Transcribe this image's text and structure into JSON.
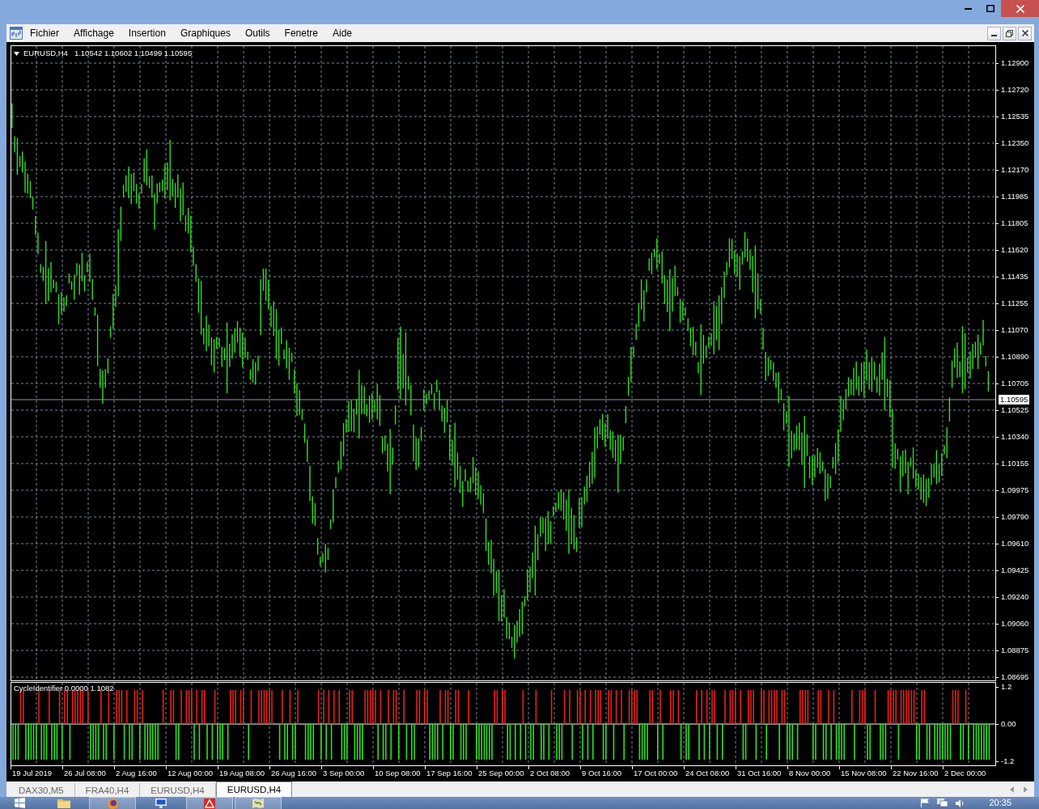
{
  "menu": [
    "Fichier",
    "Affichage",
    "Insertion",
    "Graphiques",
    "Outils",
    "Fenetre",
    "Aide"
  ],
  "chart": {
    "symbol": "EURUSD,H4",
    "ohlc": "1.10542 1.10602 1.10499 1.10595",
    "price_axis": [
      "1.12900",
      "1.12720",
      "1.12535",
      "1.12350",
      "1.12170",
      "1.11985",
      "1.11805",
      "1.11620",
      "1.11435",
      "1.11255",
      "1.11070",
      "1.10890",
      "1.10705",
      "1.10525",
      "1.10340",
      "1.10155",
      "1.09975",
      "1.09790",
      "1.09610",
      "1.09425",
      "1.09240",
      "1.09060",
      "1.08875",
      "1.08695"
    ],
    "current_price": "1.10595"
  },
  "indicator": {
    "label": "CycleIdentifier 0.0000 1.1082",
    "axis": [
      "1.2",
      "0.00",
      "-1.2"
    ]
  },
  "time_axis": [
    "19 Jul 2019",
    "26 Jul 08:00",
    "2 Aug 16:00",
    "12 Aug 00:00",
    "19 Aug 08:00",
    "26 Aug 16:00",
    "3 Sep 00:00",
    "10 Sep 08:00",
    "17 Sep 16:00",
    "25 Sep 00:00",
    "2 Oct 08:00",
    "9 Oct 16:00",
    "17 Oct 00:00",
    "24 Oct 08:00",
    "31 Oct 16:00",
    "8 Nov 00:00",
    "15 Nov 08:00",
    "22 Nov 16:00",
    "2 Dec 00:00"
  ],
  "tabs": [
    {
      "label": "DAX30,M5",
      "selected": false
    },
    {
      "label": "FRA40,H4",
      "selected": false
    },
    {
      "label": "EURUSD,H4",
      "selected": false
    },
    {
      "label": "EURUSD,H4",
      "selected": true
    }
  ],
  "taskbar": {
    "apps": [
      {
        "kind": "folder",
        "open": false
      },
      {
        "kind": "browser",
        "open": true
      },
      {
        "kind": "monitor",
        "open": false
      },
      {
        "kind": "document",
        "open": true
      },
      {
        "kind": "map",
        "open": true
      }
    ],
    "clock": "20:35"
  }
}
